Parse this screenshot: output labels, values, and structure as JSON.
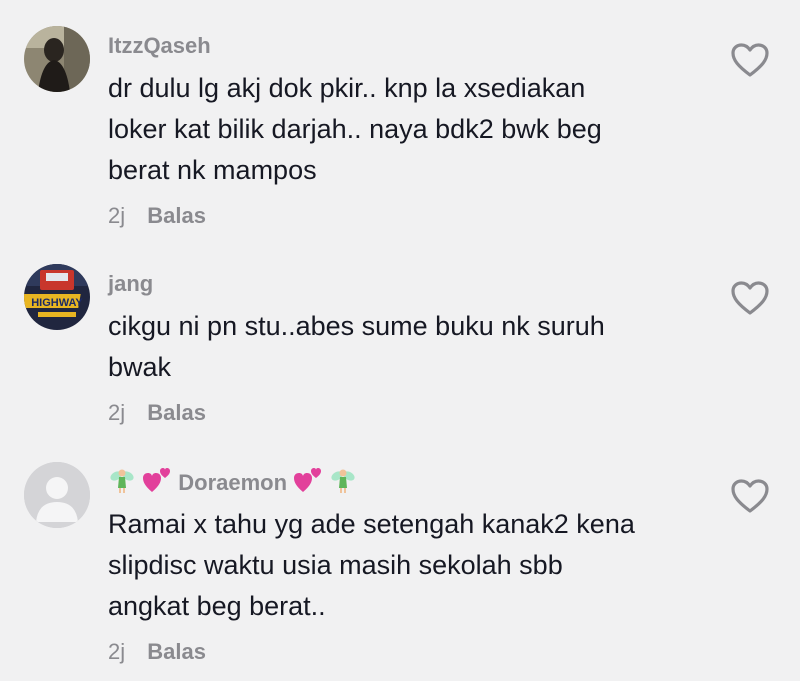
{
  "comments": [
    {
      "username": "ItzzQaseh",
      "lines": [
        "dr dulu lg akj dok pkir.. knp la xsediakan",
        "loker kat bilik darjah.. naya bdk2 bwk beg",
        "berat nk mampos"
      ],
      "time": "2j",
      "reply_label": "Balas",
      "avatar": "profile-photo"
    },
    {
      "username": "jang",
      "lines": [
        "cikgu ni pn stu..abes sume buku nk suruh",
        "bwak"
      ],
      "time": "2j",
      "reply_label": "Balas",
      "avatar": "highway-kings-logo",
      "avatar_text": "HIGHWAY"
    },
    {
      "username_prefix_icons": [
        "fairy-emoji",
        "two-hearts-emoji"
      ],
      "username": "Doraemon",
      "username_suffix_icons": [
        "two-hearts-emoji",
        "fairy-emoji"
      ],
      "lines": [
        "Ramai x tahu yg ade setengah kanak2 kena",
        "slipdisc waktu usia masih sekolah sbb",
        "angkat beg berat.."
      ],
      "time": "2j",
      "reply_label": "Balas",
      "avatar": "default-avatar"
    }
  ],
  "colors": {
    "background": "#f1f1f2",
    "text": "#161823",
    "muted": "#8a8a8f",
    "heart_outline": "#8a8a8f"
  }
}
